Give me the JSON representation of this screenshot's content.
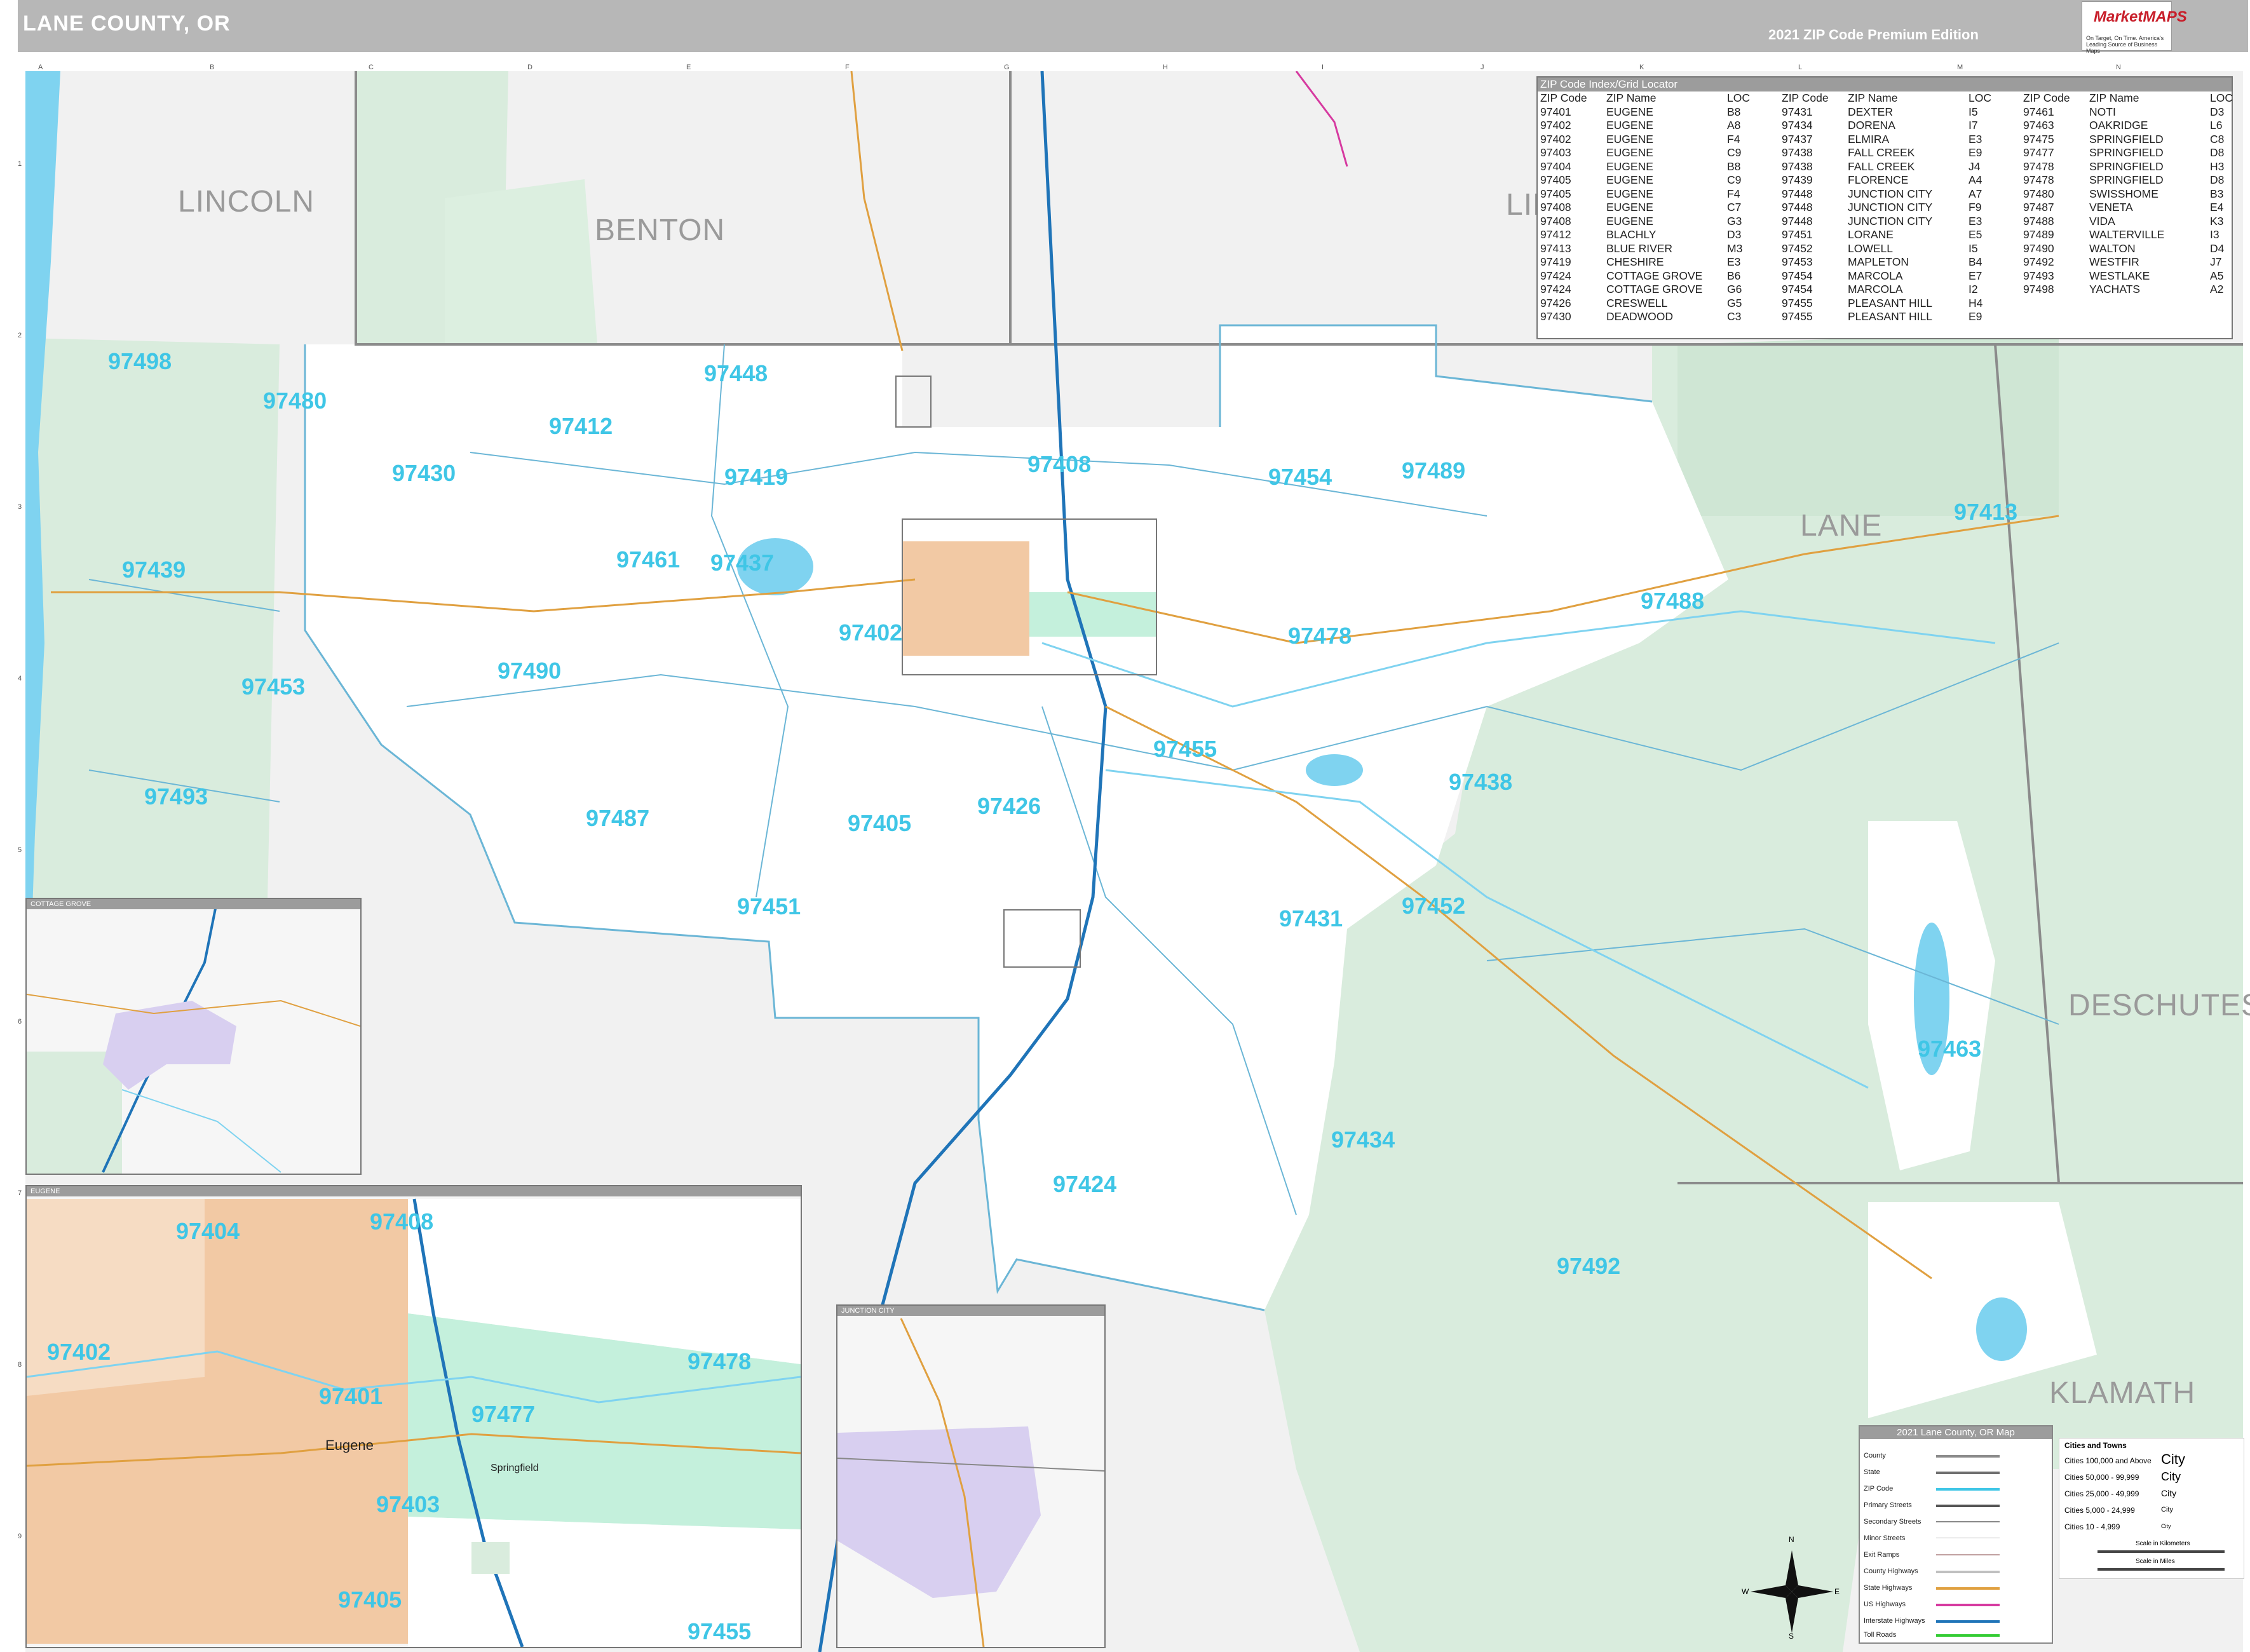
{
  "header": {
    "title": "LANE COUNTY, OR",
    "edition": "2021 ZIP Code Premium Edition",
    "logo_text": "MarketMAPS",
    "logo_tagline": "On Target, On Time. America's Leading Source of Business Maps"
  },
  "grid": {
    "letters": [
      "A",
      "B",
      "C",
      "D",
      "E",
      "F",
      "G",
      "H",
      "I",
      "J",
      "K",
      "L",
      "M",
      "N"
    ],
    "numbers": [
      "1",
      "2",
      "3",
      "4",
      "5",
      "6",
      "7",
      "8",
      "9"
    ]
  },
  "counties": {
    "lincoln": "LINCOLN",
    "benton": "BENTON",
    "linn": "LIN",
    "lane": "LANE",
    "deschutes": "DESCHUTES",
    "klamath": "KLAMATH"
  },
  "zips": {
    "z97498": "97498",
    "z97480": "97480",
    "z97448": "97448",
    "z97412": "97412",
    "z97430": "97430",
    "z97419": "97419",
    "z97408": "97408",
    "z97454": "97454",
    "z97489": "97489",
    "z97413": "97413",
    "z97439": "97439",
    "z97461": "97461",
    "z97437": "97437",
    "z97402": "97402",
    "z97478": "97478",
    "z97488": "97488",
    "z97490": "97490",
    "z97453": "97453",
    "z97455": "97455",
    "z97438": "97438",
    "z97493": "97493",
    "z97487": "97487",
    "z97405": "97405",
    "z97426": "97426",
    "z97451": "97451",
    "z97431": "97431",
    "z97452": "97452",
    "z97463": "97463",
    "z97434": "97434",
    "z97424": "97424",
    "z97492": "97492"
  },
  "eugene_inset": {
    "title": "EUGENE",
    "zips": [
      "97404",
      "97408",
      "97402",
      "97401",
      "97477",
      "97478",
      "97403",
      "97405",
      "97455"
    ],
    "city_eugene": "Eugene",
    "city_springfield": "Springfield"
  },
  "cottage_inset": {
    "title": "COTTAGE GROVE"
  },
  "junction_inset": {
    "title": "JUNCTION CITY"
  },
  "index": {
    "title": "ZIP Code Index/Grid Locator",
    "headers": [
      "ZIP Code",
      "ZIP Name",
      "LOC"
    ],
    "col1": [
      [
        "97401",
        "EUGENE",
        "B8"
      ],
      [
        "97402",
        "EUGENE",
        "A8"
      ],
      [
        "97402",
        "EUGENE",
        "F4"
      ],
      [
        "97403",
        "EUGENE",
        "C9"
      ],
      [
        "97404",
        "EUGENE",
        "B8"
      ],
      [
        "97405",
        "EUGENE",
        "C9"
      ],
      [
        "97405",
        "EUGENE",
        "F4"
      ],
      [
        "97408",
        "EUGENE",
        "C7"
      ],
      [
        "97408",
        "EUGENE",
        "G3"
      ],
      [
        "97412",
        "BLACHLY",
        "D3"
      ],
      [
        "97413",
        "BLUE RIVER",
        "M3"
      ],
      [
        "97419",
        "CHESHIRE",
        "E3"
      ],
      [
        "97424",
        "COTTAGE GROVE",
        "B6"
      ],
      [
        "97424",
        "COTTAGE GROVE",
        "G6"
      ],
      [
        "97426",
        "CRESWELL",
        "G5"
      ],
      [
        "97430",
        "DEADWOOD",
        "C3"
      ]
    ],
    "col2": [
      [
        "97431",
        "DEXTER",
        "I5"
      ],
      [
        "97434",
        "DORENA",
        "I7"
      ],
      [
        "97437",
        "ELMIRA",
        "E3"
      ],
      [
        "97438",
        "FALL CREEK",
        "E9"
      ],
      [
        "97438",
        "FALL CREEK",
        "J4"
      ],
      [
        "97439",
        "FLORENCE",
        "A4"
      ],
      [
        "97448",
        "JUNCTION CITY",
        "A7"
      ],
      [
        "97448",
        "JUNCTION CITY",
        "F9"
      ],
      [
        "97448",
        "JUNCTION CITY",
        "E3"
      ],
      [
        "97451",
        "LORANE",
        "E5"
      ],
      [
        "97452",
        "LOWELL",
        "I5"
      ],
      [
        "97453",
        "MAPLETON",
        "B4"
      ],
      [
        "97454",
        "MARCOLA",
        "E7"
      ],
      [
        "97454",
        "MARCOLA",
        "I2"
      ],
      [
        "97455",
        "PLEASANT HILL",
        "H4"
      ],
      [
        "97455",
        "PLEASANT HILL",
        "E9"
      ]
    ],
    "col3": [
      [
        "97461",
        "NOTI",
        "D3"
      ],
      [
        "97463",
        "OAKRIDGE",
        "L6"
      ],
      [
        "97475",
        "SPRINGFIELD",
        "C8"
      ],
      [
        "97477",
        "SPRINGFIELD",
        "D8"
      ],
      [
        "97478",
        "SPRINGFIELD",
        "H3"
      ],
      [
        "97478",
        "SPRINGFIELD",
        "D8"
      ],
      [
        "97480",
        "SWISSHOME",
        "B3"
      ],
      [
        "97487",
        "VENETA",
        "E4"
      ],
      [
        "97488",
        "VIDA",
        "K3"
      ],
      [
        "97489",
        "WALTERVILLE",
        "I3"
      ],
      [
        "97490",
        "WALTON",
        "D4"
      ],
      [
        "97492",
        "WESTFIR",
        "J7"
      ],
      [
        "97493",
        "WESTLAKE",
        "A5"
      ],
      [
        "97498",
        "YACHATS",
        "A2"
      ]
    ]
  },
  "legend": {
    "title": "2021 Lane County, OR Map",
    "rows": [
      "County",
      "State",
      "ZIP Code",
      "Primary Streets",
      "Secondary Streets",
      "Minor Streets",
      "Exit Ramps",
      "County Highways",
      "State Highways",
      "US Highways",
      "Interstate Highways",
      "Toll Roads"
    ],
    "cities_title": "Cities and Towns",
    "city_rows": [
      "Cities 100,000 and Above",
      "Cities 50,000 - 99,999",
      "Cities 25,000 - 49,999",
      "Cities 5,000 - 24,999",
      "Cities 10 - 4,999"
    ],
    "city_syms": [
      "City",
      "City",
      "City",
      "City",
      "City"
    ],
    "scale_km": "Scale in Kilometers",
    "scale_mi": "Scale in Miles"
  },
  "compass": {
    "n": "N",
    "s": "S",
    "e": "E",
    "w": "W"
  },
  "colors": {
    "forest": "#d9ecdd",
    "water": "#7fd3f0",
    "zip_label": "#3fc6e6",
    "eugene_fill": "#f2c9a4",
    "springfield_fill": "#c4f0dc",
    "junction_fill": "#d8cff0",
    "interstate": "#1f74b8"
  }
}
